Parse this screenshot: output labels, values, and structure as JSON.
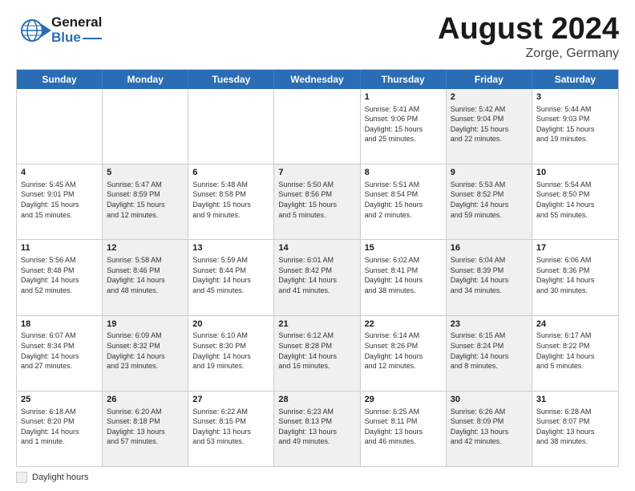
{
  "header": {
    "logo_general": "General",
    "logo_blue": "Blue",
    "title": "August 2024",
    "subtitle": "Zorge, Germany"
  },
  "calendar": {
    "days_of_week": [
      "Sunday",
      "Monday",
      "Tuesday",
      "Wednesday",
      "Thursday",
      "Friday",
      "Saturday"
    ],
    "legend_label": "Daylight hours",
    "weeks": [
      [
        {
          "day": "",
          "info": "",
          "shaded": false
        },
        {
          "day": "",
          "info": "",
          "shaded": false
        },
        {
          "day": "",
          "info": "",
          "shaded": false
        },
        {
          "day": "",
          "info": "",
          "shaded": false
        },
        {
          "day": "1",
          "info": "Sunrise: 5:41 AM\nSunset: 9:06 PM\nDaylight: 15 hours\nand 25 minutes.",
          "shaded": false
        },
        {
          "day": "2",
          "info": "Sunrise: 5:42 AM\nSunset: 9:04 PM\nDaylight: 15 hours\nand 22 minutes.",
          "shaded": true
        },
        {
          "day": "3",
          "info": "Sunrise: 5:44 AM\nSunset: 9:03 PM\nDaylight: 15 hours\nand 19 minutes.",
          "shaded": false
        }
      ],
      [
        {
          "day": "4",
          "info": "Sunrise: 5:45 AM\nSunset: 9:01 PM\nDaylight: 15 hours\nand 15 minutes.",
          "shaded": false
        },
        {
          "day": "5",
          "info": "Sunrise: 5:47 AM\nSunset: 8:59 PM\nDaylight: 15 hours\nand 12 minutes.",
          "shaded": true
        },
        {
          "day": "6",
          "info": "Sunrise: 5:48 AM\nSunset: 8:58 PM\nDaylight: 15 hours\nand 9 minutes.",
          "shaded": false
        },
        {
          "day": "7",
          "info": "Sunrise: 5:50 AM\nSunset: 8:56 PM\nDaylight: 15 hours\nand 5 minutes.",
          "shaded": true
        },
        {
          "day": "8",
          "info": "Sunrise: 5:51 AM\nSunset: 8:54 PM\nDaylight: 15 hours\nand 2 minutes.",
          "shaded": false
        },
        {
          "day": "9",
          "info": "Sunrise: 5:53 AM\nSunset: 8:52 PM\nDaylight: 14 hours\nand 59 minutes.",
          "shaded": true
        },
        {
          "day": "10",
          "info": "Sunrise: 5:54 AM\nSunset: 8:50 PM\nDaylight: 14 hours\nand 55 minutes.",
          "shaded": false
        }
      ],
      [
        {
          "day": "11",
          "info": "Sunrise: 5:56 AM\nSunset: 8:48 PM\nDaylight: 14 hours\nand 52 minutes.",
          "shaded": false
        },
        {
          "day": "12",
          "info": "Sunrise: 5:58 AM\nSunset: 8:46 PM\nDaylight: 14 hours\nand 48 minutes.",
          "shaded": true
        },
        {
          "day": "13",
          "info": "Sunrise: 5:59 AM\nSunset: 8:44 PM\nDaylight: 14 hours\nand 45 minutes.",
          "shaded": false
        },
        {
          "day": "14",
          "info": "Sunrise: 6:01 AM\nSunset: 8:42 PM\nDaylight: 14 hours\nand 41 minutes.",
          "shaded": true
        },
        {
          "day": "15",
          "info": "Sunrise: 6:02 AM\nSunset: 8:41 PM\nDaylight: 14 hours\nand 38 minutes.",
          "shaded": false
        },
        {
          "day": "16",
          "info": "Sunrise: 6:04 AM\nSunset: 8:39 PM\nDaylight: 14 hours\nand 34 minutes.",
          "shaded": true
        },
        {
          "day": "17",
          "info": "Sunrise: 6:06 AM\nSunset: 8:36 PM\nDaylight: 14 hours\nand 30 minutes.",
          "shaded": false
        }
      ],
      [
        {
          "day": "18",
          "info": "Sunrise: 6:07 AM\nSunset: 8:34 PM\nDaylight: 14 hours\nand 27 minutes.",
          "shaded": false
        },
        {
          "day": "19",
          "info": "Sunrise: 6:09 AM\nSunset: 8:32 PM\nDaylight: 14 hours\nand 23 minutes.",
          "shaded": true
        },
        {
          "day": "20",
          "info": "Sunrise: 6:10 AM\nSunset: 8:30 PM\nDaylight: 14 hours\nand 19 minutes.",
          "shaded": false
        },
        {
          "day": "21",
          "info": "Sunrise: 6:12 AM\nSunset: 8:28 PM\nDaylight: 14 hours\nand 16 minutes.",
          "shaded": true
        },
        {
          "day": "22",
          "info": "Sunrise: 6:14 AM\nSunset: 8:26 PM\nDaylight: 14 hours\nand 12 minutes.",
          "shaded": false
        },
        {
          "day": "23",
          "info": "Sunrise: 6:15 AM\nSunset: 8:24 PM\nDaylight: 14 hours\nand 8 minutes.",
          "shaded": true
        },
        {
          "day": "24",
          "info": "Sunrise: 6:17 AM\nSunset: 8:22 PM\nDaylight: 14 hours\nand 5 minutes.",
          "shaded": false
        }
      ],
      [
        {
          "day": "25",
          "info": "Sunrise: 6:18 AM\nSunset: 8:20 PM\nDaylight: 14 hours\nand 1 minute.",
          "shaded": false
        },
        {
          "day": "26",
          "info": "Sunrise: 6:20 AM\nSunset: 8:18 PM\nDaylight: 13 hours\nand 57 minutes.",
          "shaded": true
        },
        {
          "day": "27",
          "info": "Sunrise: 6:22 AM\nSunset: 8:15 PM\nDaylight: 13 hours\nand 53 minutes.",
          "shaded": false
        },
        {
          "day": "28",
          "info": "Sunrise: 6:23 AM\nSunset: 8:13 PM\nDaylight: 13 hours\nand 49 minutes.",
          "shaded": true
        },
        {
          "day": "29",
          "info": "Sunrise: 6:25 AM\nSunset: 8:11 PM\nDaylight: 13 hours\nand 46 minutes.",
          "shaded": false
        },
        {
          "day": "30",
          "info": "Sunrise: 6:26 AM\nSunset: 8:09 PM\nDaylight: 13 hours\nand 42 minutes.",
          "shaded": true
        },
        {
          "day": "31",
          "info": "Sunrise: 6:28 AM\nSunset: 8:07 PM\nDaylight: 13 hours\nand 38 minutes.",
          "shaded": false
        }
      ]
    ]
  }
}
